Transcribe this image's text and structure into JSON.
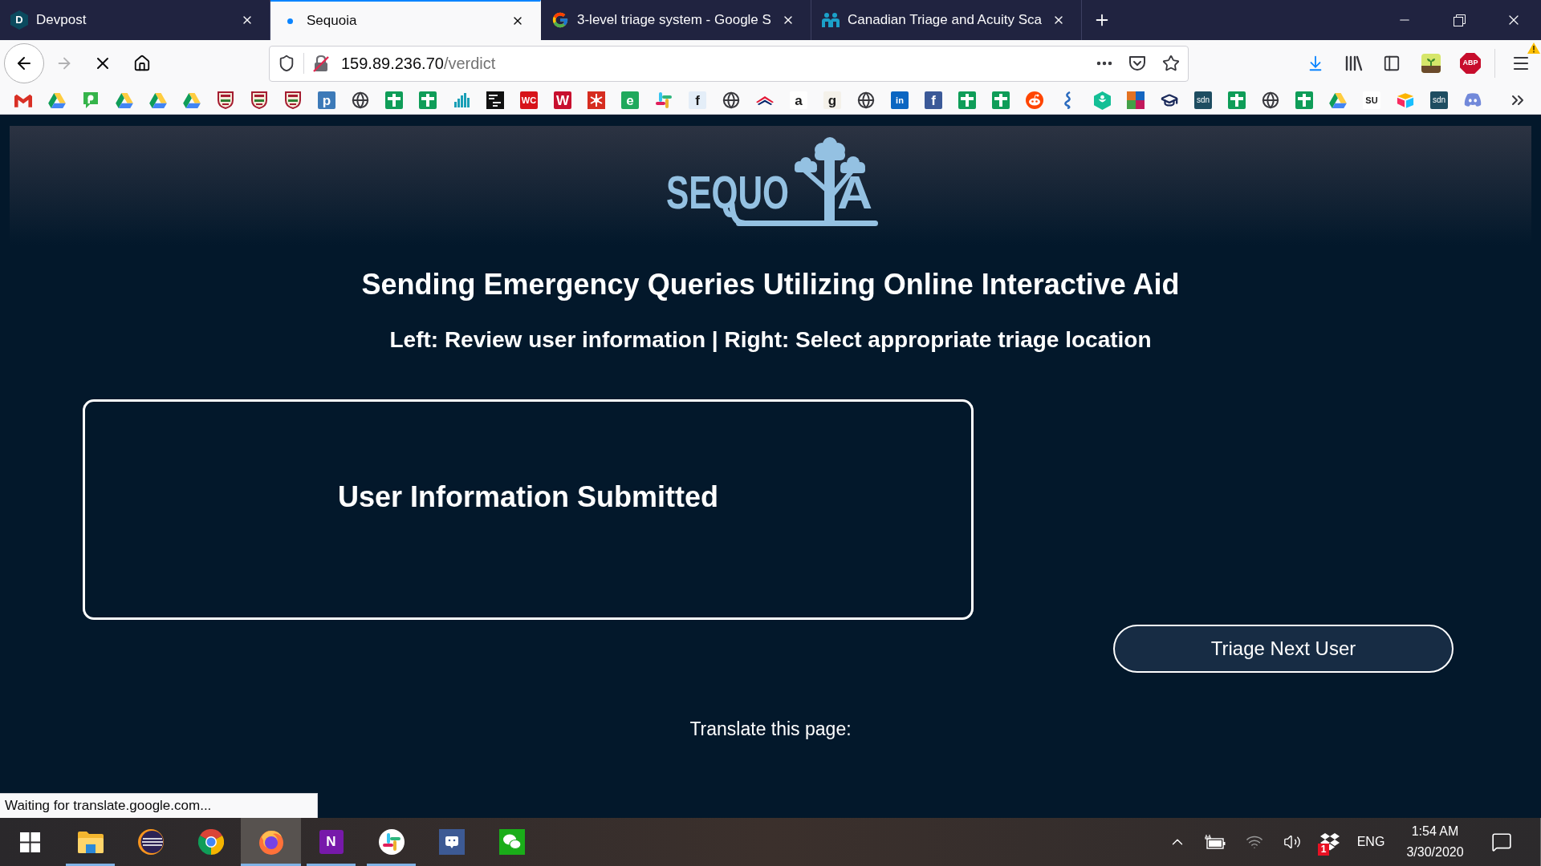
{
  "tabs": [
    {
      "title": "Devpost",
      "selected": false,
      "icon": {
        "kind": "hex-letter",
        "glyph": "D"
      }
    },
    {
      "title": "Sequoia",
      "selected": true,
      "icon": {
        "kind": "loading-dot"
      }
    },
    {
      "title": "3-level triage system - Google S",
      "selected": false,
      "icon": {
        "kind": "g-logo"
      }
    },
    {
      "title": "Canadian Triage and Acuity Sca",
      "selected": false,
      "icon": {
        "kind": "people"
      }
    }
  ],
  "nav": {
    "loading": true,
    "forward_disabled": true,
    "url": {
      "host": "159.89.236.70",
      "path": "/verdict"
    }
  },
  "extensions": [
    {
      "kind": "plant"
    },
    {
      "kind": "octagon",
      "glyph": "ABP"
    }
  ],
  "menu": {
    "warning": true
  },
  "bookmarks": [
    {
      "kind": "mail"
    },
    {
      "kind": "triangle"
    },
    {
      "kind": "bubble"
    },
    {
      "kind": "triangle"
    },
    {
      "kind": "triangle"
    },
    {
      "kind": "triangle"
    },
    {
      "kind": "crest"
    },
    {
      "kind": "crest"
    },
    {
      "kind": "crest"
    },
    {
      "kind": "letter",
      "glyph": "p",
      "color": "#3d7ab8"
    },
    {
      "kind": "globe"
    },
    {
      "kind": "plus"
    },
    {
      "kind": "plus"
    },
    {
      "kind": "chart"
    },
    {
      "kind": "dark-tile"
    },
    {
      "kind": "letter",
      "glyph": "WC",
      "color": "#d7141a"
    },
    {
      "kind": "letter",
      "glyph": "W",
      "color": "#c8102e"
    },
    {
      "kind": "snowflake"
    },
    {
      "kind": "letter",
      "glyph": "e",
      "color": "#20a95c"
    },
    {
      "kind": "hash"
    },
    {
      "kind": "letter",
      "glyph": "f",
      "color": "#e4eef8"
    },
    {
      "kind": "globe"
    },
    {
      "kind": "flag"
    },
    {
      "kind": "letter",
      "glyph": "a",
      "color": "#ffffff"
    },
    {
      "kind": "letter",
      "glyph": "g",
      "color": "#f4f1ea"
    },
    {
      "kind": "globe"
    },
    {
      "kind": "letter",
      "glyph": "in",
      "color": "#0a66c2"
    },
    {
      "kind": "letter",
      "glyph": "f",
      "color": "#3b5998"
    },
    {
      "kind": "plus"
    },
    {
      "kind": "plus"
    },
    {
      "kind": "alien"
    },
    {
      "kind": "helix"
    },
    {
      "kind": "hexagon"
    },
    {
      "kind": "grid"
    },
    {
      "kind": "cap"
    },
    {
      "kind": "letter",
      "glyph": "sdn",
      "color": "#1e4d61"
    },
    {
      "kind": "plus"
    },
    {
      "kind": "globe"
    },
    {
      "kind": "plus"
    },
    {
      "kind": "triangle"
    },
    {
      "kind": "letter",
      "glyph": "SU",
      "color": "#ffffff"
    },
    {
      "kind": "box"
    },
    {
      "kind": "letter",
      "glyph": "sdn",
      "color": "#1e4d61"
    },
    {
      "kind": "face"
    }
  ],
  "page": {
    "logo": {
      "parts": [
        "SEQUO",
        "A"
      ]
    },
    "title": "Sending Emergency Queries Utilizing Online Interactive Aid",
    "subtitle": "Left: Review user information | Right: Select appropriate triage location",
    "info_box": {
      "heading": "User Information Submitted"
    },
    "primary_button": "Triage Next User",
    "translate_label": "Translate this page:"
  },
  "status_text": "Waiting for translate.google.com...",
  "taskbar": {
    "apps": [
      {
        "kind": "folder",
        "running": true,
        "selected": false
      },
      {
        "kind": "striped-circle",
        "running": false,
        "selected": false
      },
      {
        "kind": "browser-ball",
        "running": false,
        "selected": false
      },
      {
        "kind": "flame-globe",
        "running": true,
        "selected": true
      },
      {
        "kind": "letter",
        "glyph": "N",
        "running": true,
        "selected": false
      },
      {
        "kind": "hash",
        "running": true,
        "selected": false
      },
      {
        "kind": "face-tile",
        "running": false,
        "selected": false
      },
      {
        "kind": "bubbles",
        "running": false,
        "selected": false
      }
    ],
    "tray": {
      "badge": "1",
      "language": "ENG",
      "time": "1:54 AM",
      "date": "3/30/2020"
    }
  }
}
